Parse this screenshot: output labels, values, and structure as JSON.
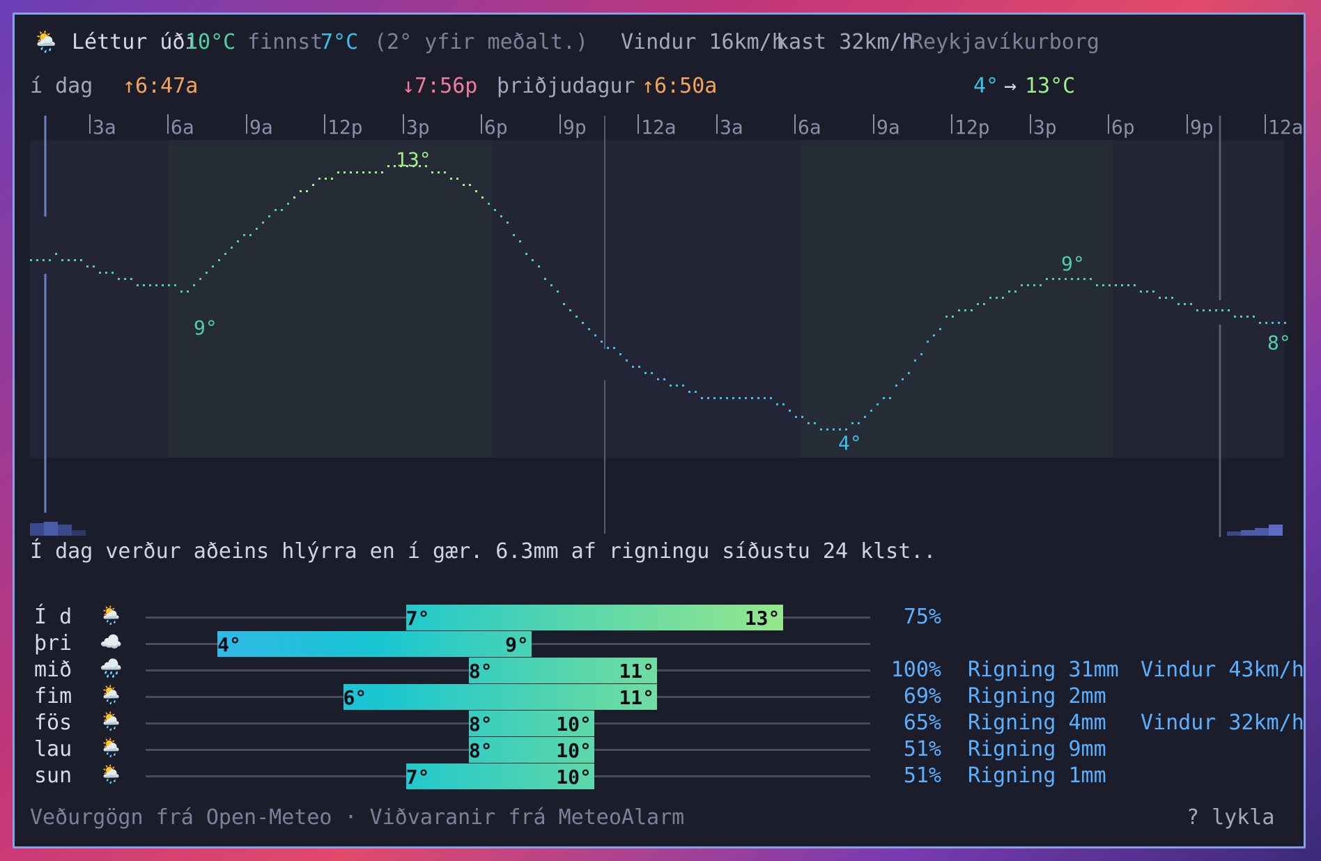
{
  "header": {
    "condition_icon": "sun-behind-rain-cloud-icon",
    "condition": "Léttur úði",
    "temp": "10°C",
    "feels_label": "finnst",
    "feels_temp": "7°C",
    "anomaly": "(2° yfir meðalt.)",
    "wind": "Vindur 16km/h",
    "gust": "kast 32km/h",
    "location": "Reykjavíkurborg"
  },
  "timeline": {
    "today_label": "í dag",
    "sunrise_today": "↑6:47a",
    "sunset_today": "↓7:56p",
    "next_day_label": "þriðjudagur",
    "sunrise_next": "↑6:50a",
    "range_low": "4°",
    "range_arrow": "→",
    "range_high": "13°C",
    "ticks": [
      "3a",
      "6a",
      "9a",
      "12p",
      "3p",
      "6p",
      "9p",
      "12a",
      "3a",
      "6a",
      "9a",
      "12p",
      "3p",
      "6p",
      "9p",
      "12a"
    ]
  },
  "chart_data": {
    "type": "line",
    "title": "",
    "xlabel": "",
    "ylabel": "",
    "x_unit": "hours from 00:00 today",
    "x": [
      0,
      1,
      2,
      3,
      4,
      5,
      6,
      7,
      8,
      9,
      10,
      11,
      12,
      13,
      14,
      15,
      16,
      17,
      18,
      19,
      20,
      21,
      22,
      23,
      24,
      25,
      26,
      27,
      28,
      29,
      30,
      31,
      32,
      33,
      34,
      35,
      36,
      37,
      38,
      39,
      40,
      41,
      42,
      43,
      44,
      45,
      46,
      47,
      48
    ],
    "series": [
      {
        "values": [
          10,
          10.2,
          10,
          9.6,
          9.3,
          9.2,
          9.1,
          9.8,
          10.7,
          11.4,
          12.1,
          12.7,
          13,
          13,
          13.1,
          13.1,
          12.9,
          12.4,
          11.5,
          10.3,
          9.1,
          8.1,
          7.3,
          6.6,
          6.2,
          5.8,
          5.5,
          5.5,
          5.6,
          5.1,
          4.6,
          4.4,
          4.9,
          5.7,
          6.9,
          8.1,
          8.5,
          8.8,
          9.2,
          9.4,
          9.4,
          9.3,
          9.2,
          9,
          8.6,
          8.4,
          8.3,
          8.1,
          7.9
        ]
      }
    ],
    "annotations": [
      {
        "text": "13°",
        "x": 14,
        "y": 13
      },
      {
        "text": "9°",
        "x": 6,
        "y": 9
      },
      {
        "text": "4°",
        "x": 32,
        "y": 4
      },
      {
        "text": "9°",
        "x": 40,
        "y": 9
      },
      {
        "text": "8°",
        "x": 48,
        "y": 8
      }
    ],
    "ylim": [
      3.5,
      14
    ],
    "grid": false,
    "colors": {
      "low": "#3bc0e8",
      "high": "#9ef08a",
      "mid": "#4fd1a5"
    }
  },
  "summary": "Í dag verður aðeins hlýrra en í gær. 6.3mm af rigningu síðustu 24 klst..",
  "forecast": {
    "scale_min": 3,
    "scale_max": 14,
    "days": [
      {
        "day": "Í d",
        "icon": "sun-behind-rain-cloud-icon",
        "glyph": "🌦️",
        "low": 7,
        "high": 13,
        "low_label": "7°",
        "high_label": "13°",
        "precip": "75%",
        "rain": "",
        "wind": ""
      },
      {
        "day": "þri",
        "icon": "cloud-icon",
        "glyph": "☁️",
        "low": 4,
        "high": 9,
        "low_label": "4°",
        "high_label": "9°",
        "precip": "",
        "rain": "",
        "wind": ""
      },
      {
        "day": "mið",
        "icon": "cloud-with-rain-icon",
        "glyph": "🌧️",
        "low": 8,
        "high": 11,
        "low_label": "8°",
        "high_label": "11°",
        "precip": "100%",
        "rain": "Rigning 31mm",
        "wind": "Vindur 43km/h"
      },
      {
        "day": "fim",
        "icon": "sun-behind-rain-cloud-icon",
        "glyph": "🌦️",
        "low": 6,
        "high": 11,
        "low_label": "6°",
        "high_label": "11°",
        "precip": "69%",
        "rain": "Rigning 2mm",
        "wind": ""
      },
      {
        "day": "fös",
        "icon": "sun-behind-rain-cloud-icon",
        "glyph": "🌦️",
        "low": 8,
        "high": 10,
        "low_label": "8°",
        "high_label": "10°",
        "precip": "65%",
        "rain": "Rigning 4mm",
        "wind": "Vindur 32km/h"
      },
      {
        "day": "lau",
        "icon": "sun-behind-rain-cloud-icon",
        "glyph": "🌦️",
        "low": 8,
        "high": 10,
        "low_label": "8°",
        "high_label": "10°",
        "precip": "51%",
        "rain": "Rigning 9mm",
        "wind": ""
      },
      {
        "day": "sun",
        "icon": "sun-behind-rain-cloud-icon",
        "glyph": "🌦️",
        "low": 7,
        "high": 10,
        "low_label": "7°",
        "high_label": "10°",
        "precip": "51%",
        "rain": "Rigning 1mm",
        "wind": ""
      }
    ]
  },
  "footer": {
    "credits": "Veðurgögn frá Open-Meteo · Viðvaranir frá MeteoAlarm",
    "keys": "? lykla"
  }
}
